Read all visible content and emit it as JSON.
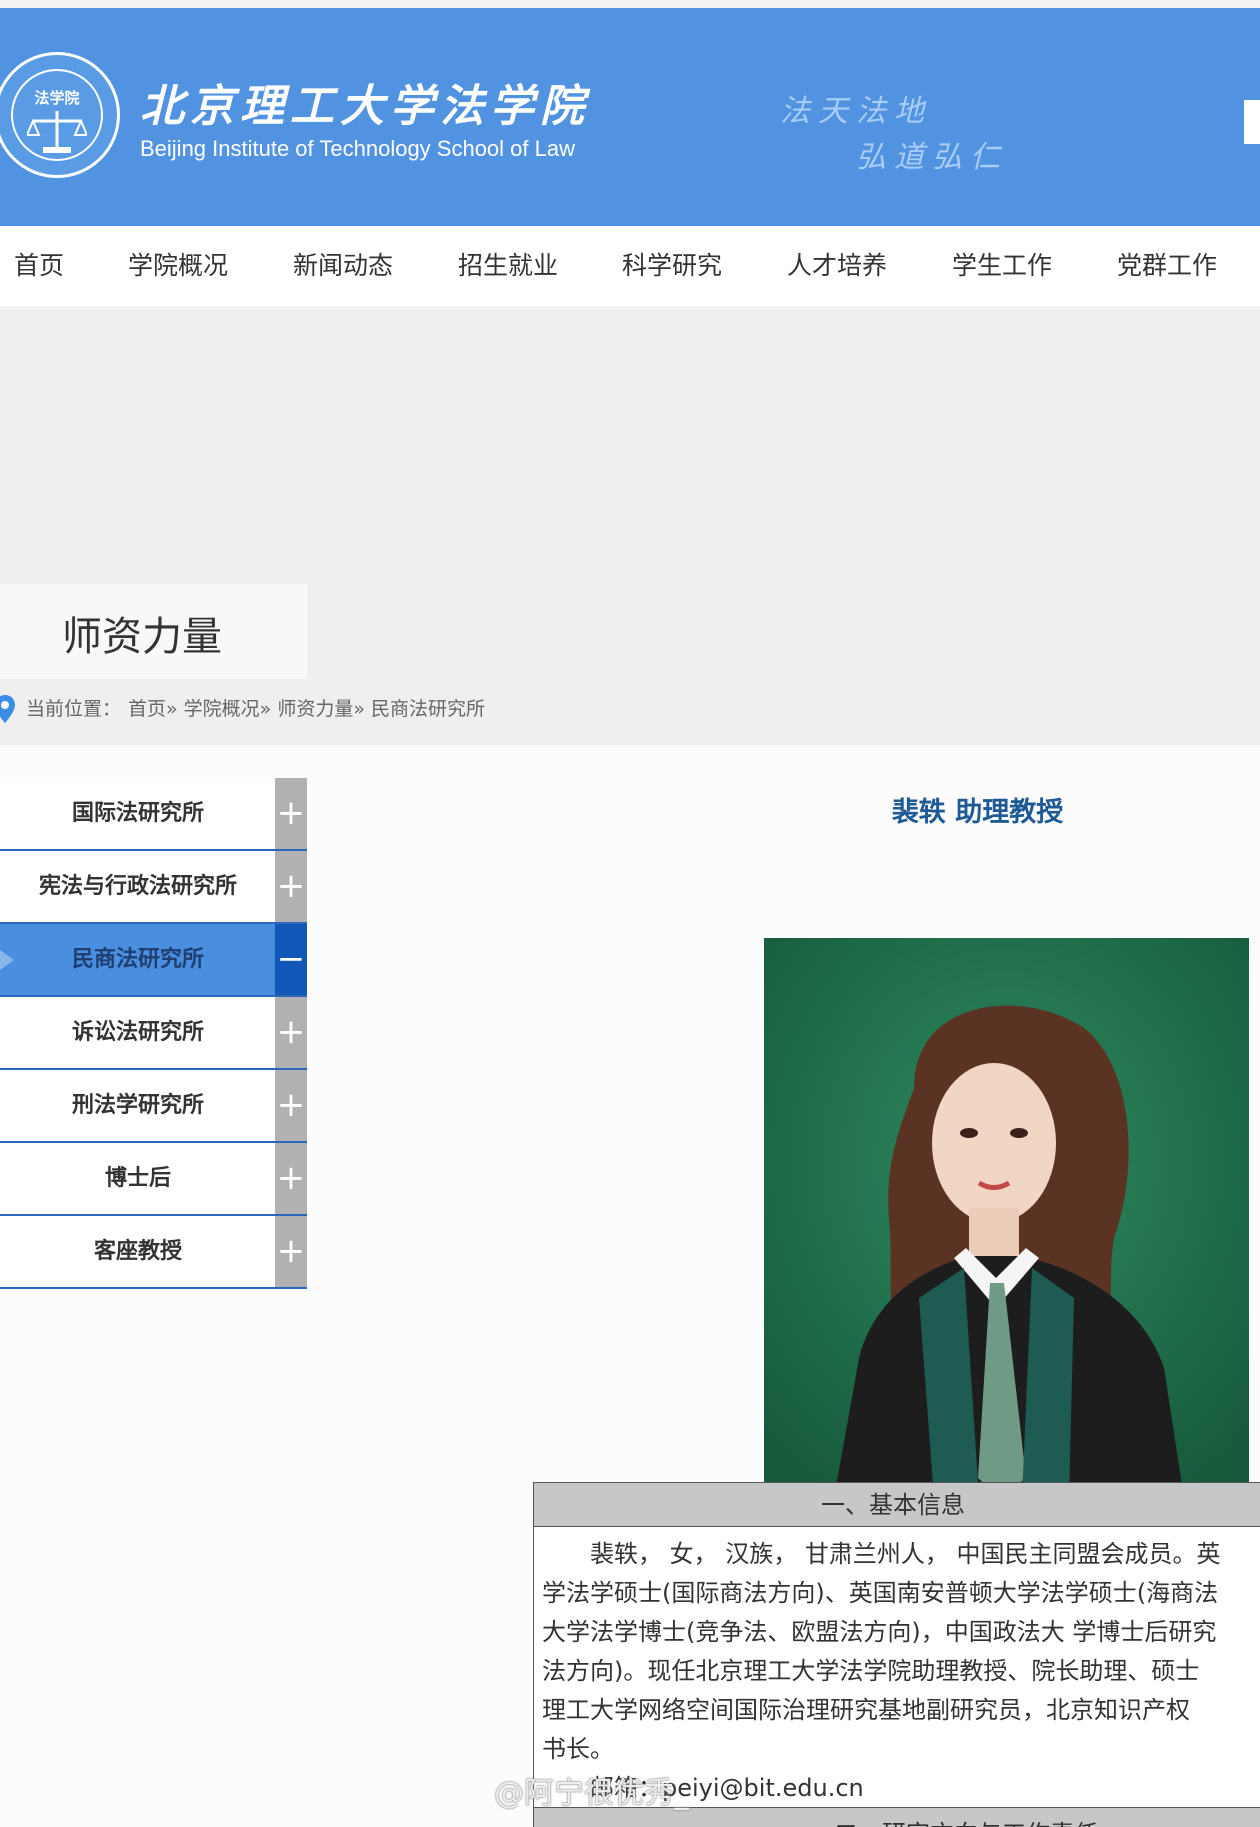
{
  "header": {
    "title_cn": "北京理工大学法学院",
    "title_en": "Beijing Institute of  Technology School of  Law",
    "motto_line1": "法天法地",
    "motto_line2": "弘道弘仁",
    "logo_text": "法学院",
    "logo_ring_text": "法天法地 弘道弘仁"
  },
  "nav": {
    "items": [
      "首页",
      "学院概况",
      "新闻动态",
      "招生就业",
      "科学研究",
      "人才培养",
      "学生工作",
      "党群工作"
    ]
  },
  "section": {
    "title": "师资力量"
  },
  "breadcrumb": {
    "label": "当前位置：",
    "path": "首页» 学院概况» 师资力量» 民商法研究所"
  },
  "sidebar": {
    "items": [
      {
        "label": "国际法研究所",
        "toggle": "+"
      },
      {
        "label": "宪法与行政法研究所",
        "toggle": "+"
      },
      {
        "label": "民商法研究所",
        "toggle": "−"
      },
      {
        "label": "诉讼法研究所",
        "toggle": "+"
      },
      {
        "label": "刑法学研究所",
        "toggle": "+"
      },
      {
        "label": "博士后",
        "toggle": "+"
      },
      {
        "label": "客座教授",
        "toggle": "+"
      }
    ]
  },
  "profile": {
    "name_title": "裴轶 助理教授",
    "info_heading": "一、基本信息",
    "info_lines": [
      "　　裴轶，  女，  汉族，  甘肃兰州人，  中国民主同盟会成员。英",
      "学法学硕士(国际商法方向)、英国南安普顿大学法学硕士(海商法",
      "大学法学博士(竞争法、欧盟法方向)，中国政法大 学博士后研究",
      "法方向)。现任北京理工大学法学院助理教授、院长助理、硕士",
      "理工大学网络空间国际治理研究基地副研究员，北京知识产权",
      "书长。",
      "　　邮箱：peiyi@bit.edu.cn"
    ],
    "next_heading": "二、研究方向与工作责任"
  },
  "watermark": "@阿宁很优秀_"
}
